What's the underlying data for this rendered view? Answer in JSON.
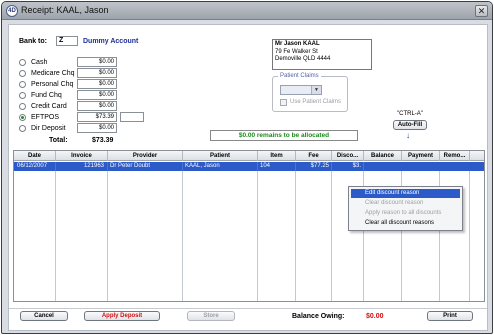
{
  "window": {
    "title": "Receipt: KAAL, Jason",
    "close_glyph": "✕",
    "app_icon_glyph": "4D"
  },
  "bank": {
    "label": "Bank to:",
    "code": "Z",
    "name": "Dummy Account"
  },
  "payments": [
    {
      "label": "Cash",
      "amount": "$0.00",
      "selected": false
    },
    {
      "label": "Medicare Chq",
      "amount": "$0.00",
      "selected": false
    },
    {
      "label": "Personal Chq",
      "amount": "$0.00",
      "selected": false
    },
    {
      "label": "Fund Chq",
      "amount": "$0.00",
      "selected": false
    },
    {
      "label": "Credit Card",
      "amount": "$0.00",
      "selected": false
    },
    {
      "label": "EFTPOS",
      "amount": "$73.39",
      "selected": true
    },
    {
      "label": "Dir Deposit",
      "amount": "$0.00",
      "selected": false
    }
  ],
  "total": {
    "label": "Total:",
    "value": "$73.39"
  },
  "address": {
    "line1": "Mr Jason KAAL",
    "line2": "79 Fe Walker St",
    "line3": "Demoville QLD 4444"
  },
  "patient_claims": {
    "title": "Patient Claims",
    "checkbox_label": "Use Patient Claims"
  },
  "autofill": {
    "shortcut": "\"CTRL-A\"",
    "button": "Auto-Fill",
    "arrow": "↓"
  },
  "allocation_message": "$0.00 remains to be allocated",
  "grid": {
    "columns": [
      "Date",
      "Invoice",
      "Provider",
      "Patient",
      "Item",
      "Fee",
      "Disco...",
      "Balance",
      "Payment",
      "Remo..."
    ],
    "rows": [
      {
        "date": "06/12/2007",
        "invoice": "121963",
        "provider": "Dr Peter Doubt",
        "patient": "KAAL, Jason",
        "item": "104",
        "fee": "$77.25",
        "discount": "$3."
      }
    ]
  },
  "context_menu": {
    "items": [
      {
        "label": "Edit discount reason",
        "state": "highlighted"
      },
      {
        "label": "Clear discount reason",
        "state": "disabled"
      },
      {
        "label": "Apply reason to all discounts",
        "state": "disabled"
      },
      {
        "label": "Clear all discount reasons",
        "state": "enabled"
      }
    ]
  },
  "footer": {
    "cancel": "Cancel",
    "apply_deposit": "Apply Deposit",
    "store": "Store",
    "balance_label": "Balance Owing:",
    "balance_value": "$0.00",
    "print": "Print"
  },
  "colors": {
    "accent": "#2c5ac8",
    "green": "#1c8a1c",
    "red": "#d01010",
    "navy": "#1f2f9c"
  }
}
